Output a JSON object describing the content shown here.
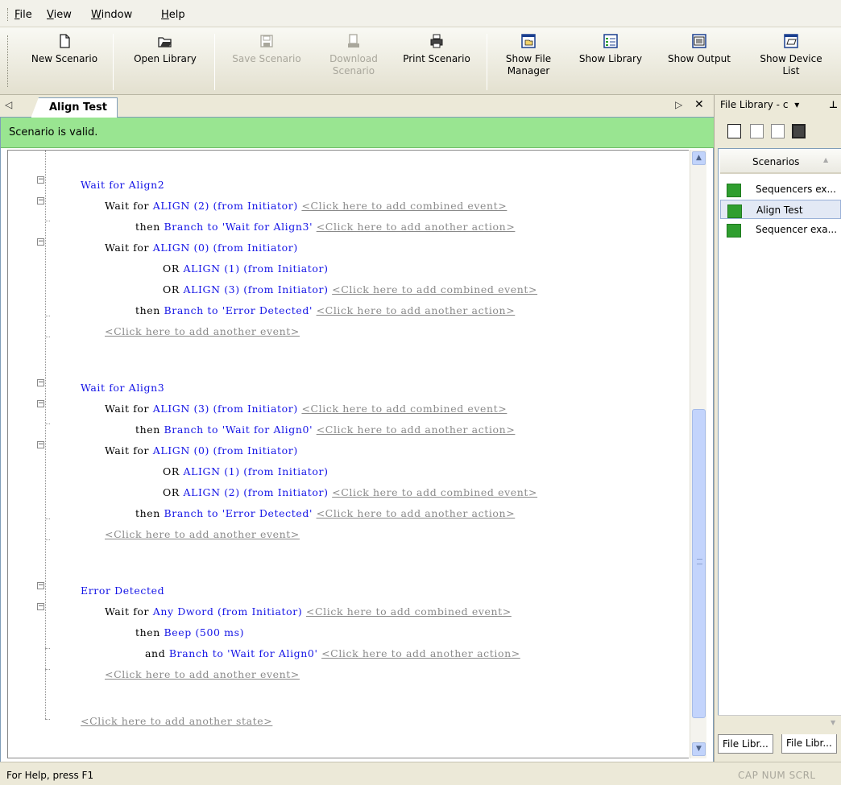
{
  "menu": {
    "items": [
      {
        "first": "F",
        "rest": "ile"
      },
      {
        "first": "V",
        "rest": "iew"
      },
      {
        "first": "W",
        "rest": "indow"
      },
      {
        "first": "H",
        "rest": "elp"
      }
    ]
  },
  "toolbar": {
    "new_scenario": "New Scenario",
    "open_library": "Open Library",
    "save_scenario": "Save Scenario",
    "download_scenario_1": "Download",
    "download_scenario_2": "Scenario",
    "print_scenario": "Print Scenario",
    "show_file_manager_1": "Show File",
    "show_file_manager_2": "Manager",
    "show_library": "Show Library",
    "show_output": "Show Output",
    "show_device_list_1": "Show Device",
    "show_device_list_2": "List"
  },
  "tabs": {
    "active": "Align Test"
  },
  "editor": {
    "status": "Scenario is valid.",
    "lines": [
      {
        "parts": [
          {
            "c": "state-title",
            "t": "Wait for Align2"
          }
        ]
      },
      {
        "parts": [
          {
            "c": "kw",
            "t": "Wait for "
          },
          {
            "c": "bl",
            "t": "ALIGN (2) (from Initiator)"
          },
          {
            "c": "kw",
            "t": " "
          },
          {
            "c": "gr",
            "t": "<Click here to add combined event>"
          }
        ]
      },
      {
        "parts": [
          {
            "c": "kw",
            "t": "then "
          },
          {
            "c": "bl",
            "t": "Branch to 'Wait for Align3'"
          },
          {
            "c": "kw",
            "t": " "
          },
          {
            "c": "gr",
            "t": "<Click here to add another action>"
          }
        ]
      },
      {
        "parts": [
          {
            "c": "kw",
            "t": "Wait for "
          },
          {
            "c": "bl",
            "t": "ALIGN (0) (from Initiator)"
          }
        ]
      },
      {
        "parts": [
          {
            "c": "kw",
            "t": "OR "
          },
          {
            "c": "bl",
            "t": "ALIGN (1) (from Initiator)"
          }
        ]
      },
      {
        "parts": [
          {
            "c": "kw",
            "t": "OR "
          },
          {
            "c": "bl",
            "t": "ALIGN (3) (from Initiator)"
          },
          {
            "c": "kw",
            "t": " "
          },
          {
            "c": "gr",
            "t": "<Click here to add combined event>"
          }
        ]
      },
      {
        "parts": [
          {
            "c": "kw",
            "t": "then "
          },
          {
            "c": "bl",
            "t": "Branch to 'Error Detected'"
          },
          {
            "c": "kw",
            "t": " "
          },
          {
            "c": "gr",
            "t": "<Click here to add another action>"
          }
        ]
      },
      {
        "parts": [
          {
            "c": "gr",
            "t": "<Click here to add another event>"
          }
        ]
      },
      {
        "parts": [
          {
            "c": "state-title",
            "t": "Wait for Align3"
          }
        ]
      },
      {
        "parts": [
          {
            "c": "kw",
            "t": "Wait for "
          },
          {
            "c": "bl",
            "t": "ALIGN (3) (from Initiator)"
          },
          {
            "c": "kw",
            "t": " "
          },
          {
            "c": "gr",
            "t": "<Click here to add combined event>"
          }
        ]
      },
      {
        "parts": [
          {
            "c": "kw",
            "t": "then "
          },
          {
            "c": "bl",
            "t": "Branch to 'Wait for Align0'"
          },
          {
            "c": "kw",
            "t": " "
          },
          {
            "c": "gr",
            "t": "<Click here to add another action>"
          }
        ]
      },
      {
        "parts": [
          {
            "c": "kw",
            "t": "Wait for "
          },
          {
            "c": "bl",
            "t": "ALIGN (0) (from Initiator)"
          }
        ]
      },
      {
        "parts": [
          {
            "c": "kw",
            "t": "OR "
          },
          {
            "c": "bl",
            "t": "ALIGN (1) (from Initiator)"
          }
        ]
      },
      {
        "parts": [
          {
            "c": "kw",
            "t": "OR "
          },
          {
            "c": "bl",
            "t": "ALIGN (2) (from Initiator)"
          },
          {
            "c": "kw",
            "t": " "
          },
          {
            "c": "gr",
            "t": "<Click here to add combined event>"
          }
        ]
      },
      {
        "parts": [
          {
            "c": "kw",
            "t": "then "
          },
          {
            "c": "bl",
            "t": "Branch to 'Error Detected'"
          },
          {
            "c": "kw",
            "t": " "
          },
          {
            "c": "gr",
            "t": "<Click here to add another action>"
          }
        ]
      },
      {
        "parts": [
          {
            "c": "gr",
            "t": "<Click here to add another event>"
          }
        ]
      },
      {
        "parts": [
          {
            "c": "state-title",
            "t": "Error Detected"
          }
        ]
      },
      {
        "parts": [
          {
            "c": "kw",
            "t": "Wait for "
          },
          {
            "c": "bl",
            "t": "Any Dword (from Initiator)"
          },
          {
            "c": "kw",
            "t": " "
          },
          {
            "c": "gr",
            "t": "<Click here to add combined event>"
          }
        ]
      },
      {
        "parts": [
          {
            "c": "kw",
            "t": "then "
          },
          {
            "c": "bl",
            "t": "Beep (500 ms)"
          }
        ]
      },
      {
        "parts": [
          {
            "c": "kw",
            "t": "and "
          },
          {
            "c": "bl",
            "t": "Branch to 'Wait for Align0'"
          },
          {
            "c": "kw",
            "t": " "
          },
          {
            "c": "gr",
            "t": "<Click here to add another action>"
          }
        ]
      },
      {
        "parts": [
          {
            "c": "gr",
            "t": "<Click here to add another event>"
          }
        ]
      },
      {
        "parts": [
          {
            "c": "gr",
            "t": "<Click here to add another state>"
          }
        ]
      }
    ]
  },
  "library": {
    "title": "File Library - c",
    "column_header": "Scenarios",
    "items": [
      "Sequencers ex...",
      "Align Test",
      "Sequencer exa..."
    ],
    "selected_index": 1,
    "bottom_tabs": [
      "File Libr...",
      "File Libr..."
    ]
  },
  "statusbar": {
    "help": "For Help, press F1",
    "indicators": "CAP  NUM  SCRL"
  },
  "colors": {
    "valid_banner": "#99e591",
    "keyword_blue": "#1515e6",
    "placeholder_gray": "#8a8a8a",
    "library_item_green": "#2f9e2f"
  }
}
